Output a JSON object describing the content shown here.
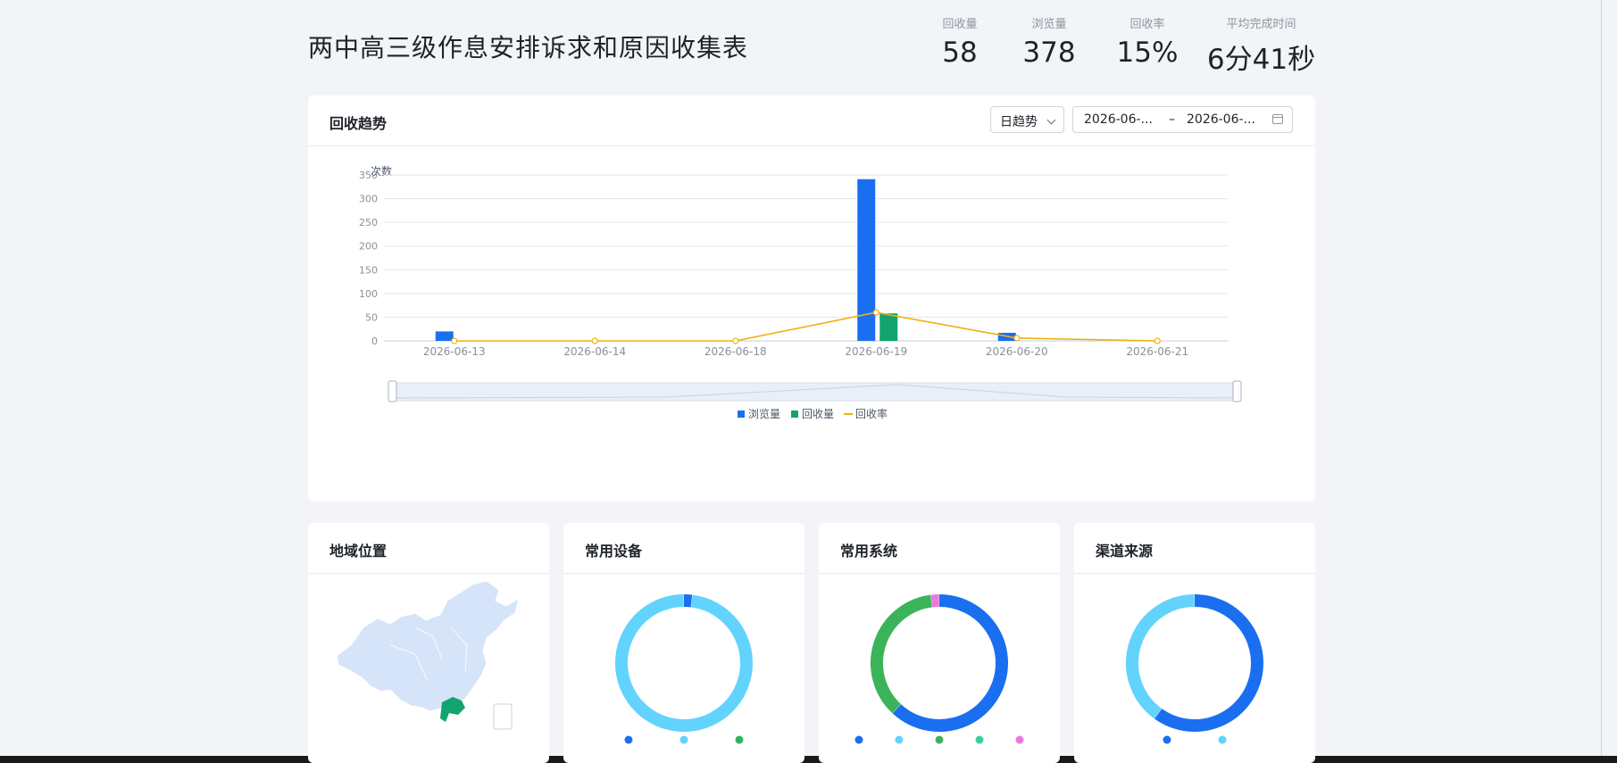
{
  "page": {
    "title": "两中高三级作息安排诉求和原因收集表"
  },
  "stats": [
    {
      "label": "回收量",
      "value": "58"
    },
    {
      "label": "浏览量",
      "value": "378"
    },
    {
      "label": "回收率",
      "value": "15%"
    },
    {
      "label": "平均完成时间",
      "value": "6分41秒"
    }
  ],
  "trend": {
    "title": "回收趋势",
    "granularity": "日趋势",
    "date_start": "2026-06-...",
    "date_sep": "–",
    "date_end": "2026-06-..."
  },
  "chart_data": {
    "type": "bar",
    "ylabel": "次数",
    "ylim": [
      0,
      350
    ],
    "yticks": [
      "0",
      "50",
      "100",
      "150",
      "200",
      "250",
      "300",
      "350"
    ],
    "categories": [
      "2026-06-13",
      "2026-06-14",
      "2026-06-18",
      "2026-06-19",
      "2026-06-20",
      "2026-06-21"
    ],
    "series": [
      {
        "name": "浏览量",
        "type": "bar",
        "color": "#1a6ff0",
        "values": [
          20,
          0,
          0,
          341,
          17,
          0
        ]
      },
      {
        "name": "回收量",
        "type": "bar",
        "color": "#12a36e",
        "values": [
          0,
          0,
          0,
          58,
          0,
          0
        ]
      },
      {
        "name": "回收率",
        "type": "line",
        "color": "#f0b010",
        "values": [
          0,
          0,
          0,
          60,
          6,
          0
        ]
      }
    ],
    "legend": "bottom",
    "grid": true
  },
  "cards": {
    "region": {
      "title": "地域位置"
    },
    "device": {
      "title": "常用设备"
    },
    "os": {
      "title": "常用系统"
    },
    "channel": {
      "title": "渠道来源"
    }
  },
  "donuts": {
    "device": {
      "colors": [
        "#1a6ff0",
        "#62d3fc"
      ],
      "fractions": [
        0.02,
        0.98
      ],
      "legend_colors": [
        "#1a6ff0",
        "#62d3fc",
        "#2fb35a"
      ]
    },
    "os": {
      "colors": [
        "#1a6ff0",
        "#3bb359",
        "#e879e0"
      ],
      "fractions": [
        0.62,
        0.36,
        0.02
      ],
      "legend_colors": [
        "#1a6ff0",
        "#62d3fc",
        "#3bb359",
        "#35d39a",
        "#e879e0"
      ]
    },
    "channel": {
      "colors": [
        "#1a6ff0",
        "#62d3fc"
      ],
      "fractions": [
        0.6,
        0.4
      ],
      "legend_colors": [
        "#1a6ff0",
        "#62d3fc"
      ]
    }
  }
}
